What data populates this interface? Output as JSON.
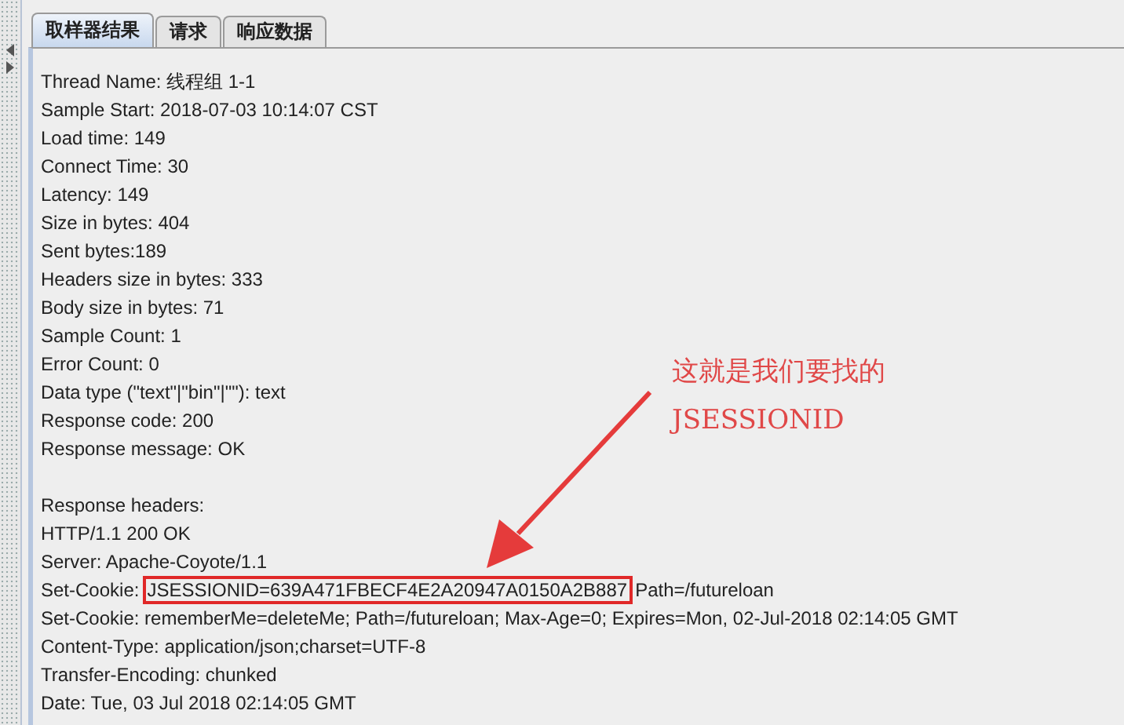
{
  "tabs": [
    {
      "label": "取样器结果",
      "selected": true
    },
    {
      "label": "请求",
      "selected": false
    },
    {
      "label": "响应数据",
      "selected": false
    }
  ],
  "sample_info": [
    "Thread Name: 线程组 1-1",
    "Sample Start: 2018-07-03 10:14:07 CST",
    "Load time: 149",
    "Connect Time: 30",
    "Latency: 149",
    "Size in bytes: 404",
    "Sent bytes:189",
    "Headers size in bytes: 333",
    "Body size in bytes: 71",
    "Sample Count: 1",
    "Error Count: 0",
    "Data type (\"text\"|\"bin\"|\"\"): text",
    "Response code: 200",
    "Response message: OK"
  ],
  "response_headers": [
    {
      "kind": "plain",
      "text": "Response headers:"
    },
    {
      "kind": "plain",
      "text": "HTTP/1.1 200 OK"
    },
    {
      "kind": "plain",
      "text": "Server: Apache-Coyote/1.1"
    },
    {
      "kind": "highlighted",
      "prefix": "Set-Cookie:",
      "value": "JSESSIONID=639A471FBECF4E2A20947A0150A2B887",
      "suffix": "Path=/futureloan"
    },
    {
      "kind": "plain",
      "text": "Set-Cookie: rememberMe=deleteMe; Path=/futureloan; Max-Age=0; Expires=Mon, 02-Jul-2018 02:14:05 GMT"
    },
    {
      "kind": "plain",
      "text": "Content-Type: application/json;charset=UTF-8"
    },
    {
      "kind": "plain",
      "text": "Transfer-Encoding: chunked"
    },
    {
      "kind": "plain",
      "text": "Date: Tue, 03 Jul 2018 02:14:05 GMT"
    }
  ],
  "annotation": [
    "这就是我们要找的",
    "JSESSIONID"
  ]
}
